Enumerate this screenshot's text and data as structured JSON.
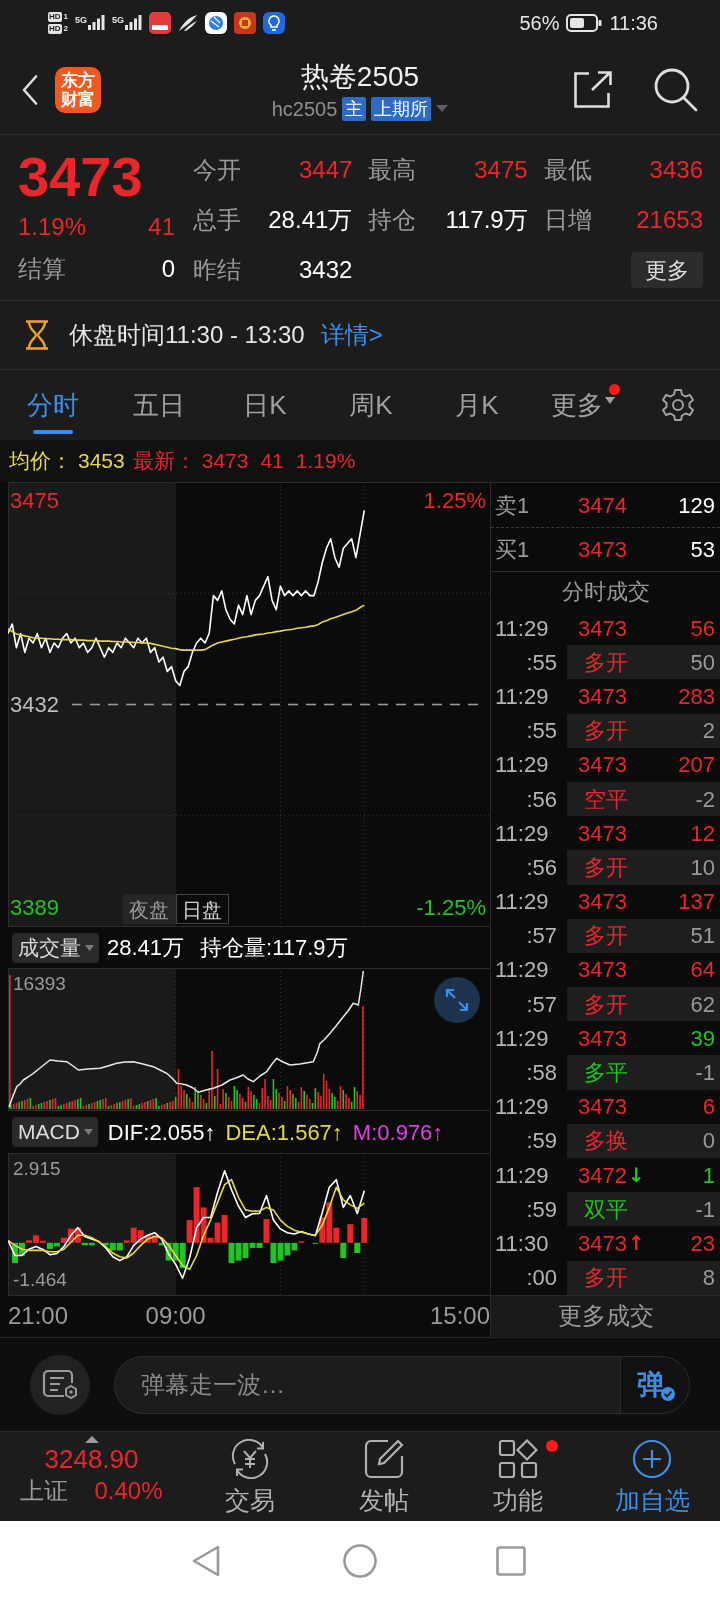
{
  "status_bar": {
    "sims": [
      {
        "badge": "HD",
        "slot": "1"
      },
      {
        "badge": "HD",
        "slot": "2"
      }
    ],
    "networks": [
      "5G",
      "5G"
    ],
    "battery": "56%",
    "time": "11:36"
  },
  "header": {
    "logo": "东方财富",
    "title": "热卷2505",
    "code": "hc2505",
    "tags": [
      "主",
      "上期所"
    ]
  },
  "quote": {
    "price": "3473",
    "change_pct": "1.19%",
    "change": "41",
    "settle_label": "结算",
    "settle_value": "0",
    "fields": [
      {
        "label": "今开",
        "value": "3447",
        "color": "#e8262b"
      },
      {
        "label": "最高",
        "value": "3475",
        "color": "#e8262b"
      },
      {
        "label": "最低",
        "value": "3436",
        "color": "#e8262b"
      },
      {
        "label": "总手",
        "value": "28.41万",
        "color": "#ffffff"
      },
      {
        "label": "持仓",
        "value": "117.9万",
        "color": "#ffffff"
      },
      {
        "label": "日增",
        "value": "21653",
        "color": "#e8262b"
      },
      {
        "label": "昨结",
        "value": "3432",
        "color": "#ffffff"
      }
    ],
    "more_button": "更多"
  },
  "session_notice": {
    "text": "休盘时间11:30 - 13:30",
    "link": "详情>"
  },
  "tabs": [
    {
      "label": "分时",
      "selected": true,
      "menu": false,
      "notify": false
    },
    {
      "label": "五日",
      "selected": false,
      "menu": false,
      "notify": false
    },
    {
      "label": "日K",
      "selected": false,
      "menu": false,
      "notify": false
    },
    {
      "label": "周K",
      "selected": false,
      "menu": false,
      "notify": false
    },
    {
      "label": "月K",
      "selected": false,
      "menu": false,
      "notify": false
    },
    {
      "label": "更多",
      "selected": false,
      "menu": true,
      "notify": true
    }
  ],
  "info_line": {
    "avg_label": "均价：",
    "avg_value": "3453",
    "latest_label": "最新：",
    "latest_value": "3473",
    "latest_change": "41",
    "latest_pct": "1.19%"
  },
  "price_chart": {
    "right_labels": [
      "1.25%",
      "-1.25%"
    ],
    "sessions": [
      {
        "label": "夜盘",
        "selected": false
      },
      {
        "label": "日盘",
        "selected": true
      }
    ],
    "chart_data": {
      "type": "line",
      "categories": [
        null,
        null,
        null,
        null,
        null,
        null,
        null,
        null,
        null,
        null,
        null,
        null,
        null,
        null,
        null,
        null,
        null,
        null,
        null,
        null,
        null,
        null,
        null,
        null,
        null,
        null,
        null,
        null,
        null,
        null,
        null,
        null,
        null,
        null,
        null,
        null,
        null,
        null,
        null,
        null,
        null,
        null,
        null,
        null,
        null,
        null,
        null,
        null,
        null,
        null,
        null,
        null,
        null,
        null,
        null,
        null,
        null,
        null,
        null,
        null,
        null,
        null,
        null,
        null,
        null,
        null,
        null,
        null,
        null,
        null,
        null,
        null,
        null,
        null,
        null,
        null,
        null,
        null,
        null,
        null,
        null,
        null,
        null,
        null,
        null,
        null,
        null,
        null,
        null,
        null,
        null,
        null,
        null,
        null,
        null,
        null,
        null,
        null,
        null,
        null,
        null,
        null,
        null,
        null,
        null,
        null,
        null,
        null,
        null,
        null,
        null,
        null,
        null,
        null,
        null,
        null
      ],
      "ylim": [
        3385,
        3479
      ],
      "yticks": [
        3475,
        3432,
        3389
      ],
      "grid": true,
      "series": [
        {
          "color": "#ffffff",
          "values": [
            3447,
            3449,
            3444,
            3447,
            3443,
            3446,
            3445,
            3447,
            3444,
            3446,
            3443,
            3445,
            3444,
            3446,
            3447,
            3445,
            3446,
            3444,
            3445,
            3443,
            3444,
            3446,
            3444,
            3442,
            3444,
            3443,
            3445,
            3444,
            3446,
            3445,
            3444,
            3446,
            3445,
            3446,
            3443,
            3444,
            3441,
            3442,
            3439,
            3440,
            3437,
            3436,
            3439,
            3440,
            3443,
            3445,
            3446,
            3445,
            3447,
            3455,
            3454,
            3456,
            3452,
            3450,
            3449,
            3453,
            3451,
            3455,
            3451,
            3454,
            3455,
            3457,
            3459,
            3454,
            3452,
            3457,
            3455,
            3456,
            3455,
            3456,
            3455,
            3456,
            3455,
            3455,
            3458,
            3462,
            3465,
            3467,
            3463,
            3461,
            3465,
            3466,
            3467,
            3463,
            3468,
            3473,
            null,
            null,
            null,
            null,
            null,
            null,
            null,
            null,
            null,
            null,
            null,
            null,
            null,
            null,
            null,
            null,
            null,
            null,
            null,
            null,
            null,
            null,
            null,
            null,
            null,
            null,
            null,
            null,
            null,
            null
          ]
        },
        {
          "color": "#e6d84a",
          "values": [
            3448,
            3447.4,
            3446.9,
            3446.7,
            3446.5,
            3446.3,
            3446.1,
            3446,
            3446,
            3445.9,
            3445.9,
            3445.8,
            3445.8,
            3445.7,
            3445.7,
            3445.7,
            3445.6,
            3445.6,
            3445.6,
            3445.5,
            3445.5,
            3445.5,
            3445.4,
            3445.4,
            3445.4,
            3445.3,
            3445.3,
            3445.2,
            3445.2,
            3445.2,
            3445.1,
            3445.1,
            3445,
            3445,
            3444.9,
            3444.7,
            3444.5,
            3444.3,
            3444.1,
            3443.9,
            3443.8,
            3443.6,
            3443.5,
            3443.5,
            3443.5,
            3443.5,
            3443.5,
            3443.6,
            3444.1,
            3444.6,
            3445,
            3445.2,
            3445.4,
            3445.6,
            3445.8,
            3446,
            3446.2,
            3446.3,
            3446.5,
            3446.7,
            3446.8,
            3446.9,
            3447.1,
            3447.2,
            3447.4,
            3447.5,
            3447.7,
            3447.8,
            3447.9,
            3448.1,
            3448.2,
            3448.3,
            3448.5,
            3448.6,
            3448.9,
            3449.4,
            3449.7,
            3450.1,
            3450.4,
            3450.7,
            3451,
            3451.3,
            3451.6,
            3451.9,
            3452.5,
            3453,
            null,
            null,
            null,
            null,
            null,
            null,
            null,
            null,
            null,
            null,
            null,
            null,
            null,
            null,
            null,
            null,
            null,
            null,
            null,
            null,
            null,
            null,
            null,
            null,
            null,
            null,
            null,
            null,
            null,
            null
          ]
        }
      ]
    }
  },
  "volume_panel": {
    "selector": "成交量",
    "volume": "28.41万",
    "open_interest": "持仓量:117.9万",
    "max_label": "16393"
  },
  "macd_panel": {
    "selector": "MACD",
    "legend": [
      {
        "text": "DIF:2.055↑",
        "color": "#ffffff"
      },
      {
        "text": "DEA:1.567↑",
        "color": "#e6d84a"
      },
      {
        "text": "M:0.976↑",
        "color": "#e040e0"
      }
    ],
    "chart_data": {
      "type": "line",
      "categories": [
        null,
        null,
        null,
        null,
        null,
        null,
        null,
        null,
        null,
        null,
        null,
        null,
        null,
        null,
        null,
        null,
        null,
        null,
        null,
        null,
        null,
        null,
        null,
        null,
        null,
        null,
        null,
        null,
        null,
        null,
        null,
        null,
        null,
        null,
        null,
        null,
        null,
        null,
        null,
        null,
        null,
        null,
        null,
        null,
        null,
        null,
        null,
        null,
        null,
        null,
        null,
        null,
        null,
        null,
        null,
        null,
        null,
        null,
        null,
        null,
        null,
        null,
        null,
        null,
        null,
        null,
        null,
        null,
        null,
        null
      ],
      "ylim": [
        -2.1,
        3.55
      ],
      "yticks": [
        2.915,
        -1.464
      ],
      "series": [
        {
          "color": "#ffffff",
          "values": [
            0.1,
            -0.5,
            -0.5,
            -0.25,
            -0.15,
            -0.26,
            -0.47,
            -0.42,
            -0.15,
            0.3,
            0.6,
            0.25,
            0.15,
            0.05,
            -0.2,
            -0.55,
            -0.7,
            -0.55,
            -0.1,
            0.15,
            0.3,
            0.4,
            0.15,
            -0.45,
            -0.85,
            -1.4,
            -0.6,
            0.6,
            1.0,
            1.0,
            2.0,
            2.85,
            2.1,
            1.45,
            1.0,
            1.15,
            1.16,
            1.87,
            0.9,
            0.55,
            0.4,
            0.35,
            0.45,
            0.35,
            0.28,
            1.2,
            2.2,
            2.5,
            1.4,
            1.87,
            1.16,
            2.06,
            null,
            null,
            null,
            null,
            null,
            null,
            null,
            null,
            null,
            null,
            null,
            null,
            null,
            null,
            null,
            null,
            null,
            null
          ]
        },
        {
          "color": "#e6d84a",
          "values": [
            0.1,
            -0.1,
            -0.25,
            -0.3,
            -0.3,
            -0.3,
            -0.35,
            -0.35,
            -0.25,
            0.02,
            0.3,
            0.3,
            0.2,
            0.05,
            -0.15,
            -0.4,
            -0.55,
            -0.6,
            -0.4,
            -0.1,
            0.15,
            0.25,
            0.2,
            -0.1,
            -0.5,
            -0.9,
            -1.05,
            -0.5,
            0.3,
            0.9,
            1.6,
            2.3,
            2.5,
            1.8,
            1.3,
            1.25,
            1.26,
            1.4,
            1.3,
            0.9,
            0.65,
            0.5,
            0.42,
            0.35,
            0.3,
            0.7,
            1.4,
            2.2,
            1.7,
            1.5,
            1.36,
            1.57,
            null,
            null,
            null,
            null,
            null,
            null,
            null,
            null,
            null,
            null,
            null,
            null,
            null,
            null,
            null,
            null,
            null,
            null
          ]
        }
      ]
    }
  },
  "time_axis": [
    "21:00",
    "09:00",
    "15:00"
  ],
  "order_book": [
    {
      "side": "卖1",
      "price": "3474",
      "volume": "129"
    },
    {
      "side": "买1",
      "price": "3473",
      "volume": "53"
    }
  ],
  "trades_title": "分时成交",
  "trades": [
    {
      "time": "11:29",
      "seconds": ":55",
      "price": "3473",
      "volume": {
        "text": "56",
        "color": "#e8262b"
      },
      "type": {
        "text": "多开",
        "color": "#e8262b"
      },
      "change": "50"
    },
    {
      "time": "11:29",
      "seconds": ":55",
      "price": "3473",
      "volume": {
        "text": "283",
        "color": "#e8262b"
      },
      "type": {
        "text": "多开",
        "color": "#e8262b"
      },
      "change": "2"
    },
    {
      "time": "11:29",
      "seconds": ":56",
      "price": "3473",
      "volume": {
        "text": "207",
        "color": "#e8262b"
      },
      "type": {
        "text": "空平",
        "color": "#e8262b"
      },
      "change": "-2"
    },
    {
      "time": "11:29",
      "seconds": ":56",
      "price": "3473",
      "volume": {
        "text": "12",
        "color": "#e8262b"
      },
      "type": {
        "text": "多开",
        "color": "#e8262b"
      },
      "change": "10"
    },
    {
      "time": "11:29",
      "seconds": ":57",
      "price": "3473",
      "volume": {
        "text": "137",
        "color": "#e8262b"
      },
      "type": {
        "text": "多开",
        "color": "#e8262b"
      },
      "change": "51"
    },
    {
      "time": "11:29",
      "seconds": ":57",
      "price": "3473",
      "volume": {
        "text": "64",
        "color": "#e8262b"
      },
      "type": {
        "text": "多开",
        "color": "#e8262b"
      },
      "change": "62"
    },
    {
      "time": "11:29",
      "seconds": ":58",
      "price": "3473",
      "volume": {
        "text": "39",
        "color": "#22c322"
      },
      "type": {
        "text": "多平",
        "color": "#22c322"
      },
      "change": "-1"
    },
    {
      "time": "11:29",
      "seconds": ":59",
      "price": "3473",
      "volume": {
        "text": "6",
        "color": "#e8262b"
      },
      "type": {
        "text": "多换",
        "color": "#e8262b"
      },
      "change": "0"
    },
    {
      "time": "11:29",
      "seconds": ":59",
      "price": "3472",
      "tick": {
        "text": "↓",
        "color": "#22c322"
      },
      "volume": {
        "text": "1",
        "color": "#22c322"
      },
      "type": {
        "text": "双平",
        "color": "#22c322"
      },
      "change": "-1"
    },
    {
      "time": "11:30",
      "seconds": ":00",
      "price": "3473",
      "tick": {
        "text": "↑",
        "color": "#e8262b"
      },
      "volume": {
        "text": "23",
        "color": "#e8262b"
      },
      "type": {
        "text": "多开",
        "color": "#e8262b"
      },
      "change": "8"
    }
  ],
  "more_trades": "更多成交",
  "comment_bar": {
    "placeholder": "弹幕走一波…",
    "send": "弹"
  },
  "bottom_nav": {
    "index": {
      "value": "3248.90",
      "name": "上证",
      "change": "0.40%"
    },
    "items": [
      {
        "kind": "trade",
        "label": "交易",
        "accent": false,
        "notify": false
      },
      {
        "kind": "post",
        "label": "发帖",
        "accent": false,
        "notify": false
      },
      {
        "kind": "tools",
        "label": "功能",
        "accent": false,
        "notify": true
      },
      {
        "kind": "add",
        "label": "加自选",
        "accent": true,
        "notify": false
      }
    ]
  }
}
